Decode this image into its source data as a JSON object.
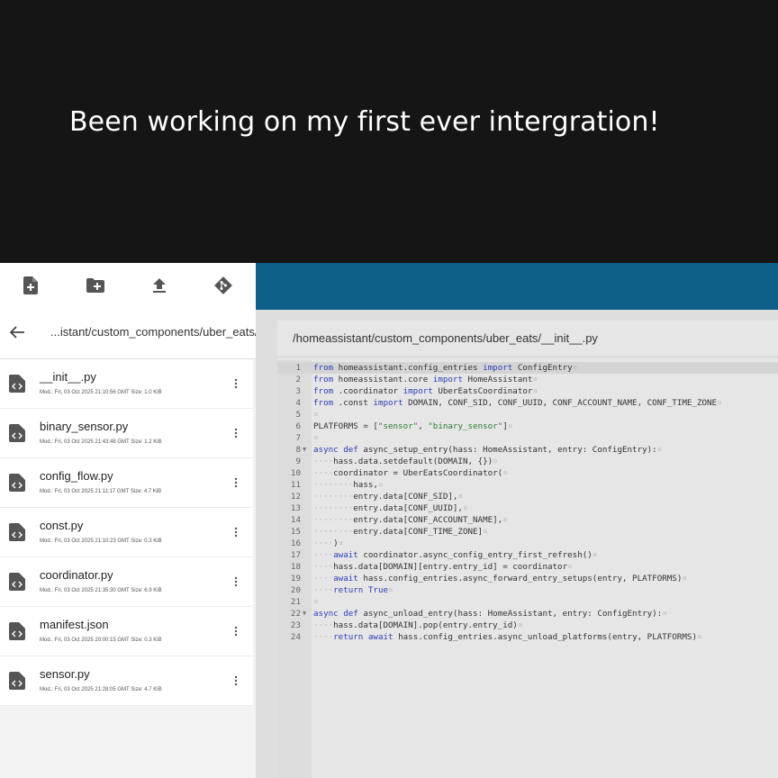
{
  "banner": {
    "caption": "Been working on my first ever intergration!"
  },
  "file_browser": {
    "toolbar": [
      {
        "icon": "new-file-icon",
        "name": "new-file-button"
      },
      {
        "icon": "new-folder-icon",
        "name": "new-folder-button"
      },
      {
        "icon": "upload-icon",
        "name": "upload-button"
      },
      {
        "icon": "git-icon",
        "name": "git-button"
      }
    ],
    "path": "...istant/custom_components/uber_eats/",
    "files": [
      {
        "name": "__init__.py",
        "meta": "Mod.: Fri, 03 Oct 2025 21:10:56 GMT  Size: 1.0 KiB"
      },
      {
        "name": "binary_sensor.py",
        "meta": "Mod.: Fri, 03 Oct 2025 21:43:48 GMT  Size: 1.2 KiB"
      },
      {
        "name": "config_flow.py",
        "meta": "Mod.: Fri, 03 Oct 2025 21:11:17 GMT  Size: 4.7 KiB"
      },
      {
        "name": "const.py",
        "meta": "Mod.: Fri, 03 Oct 2025 21:10:23 GMT  Size: 0.3 KiB"
      },
      {
        "name": "coordinator.py",
        "meta": "Mod.: Fri, 03 Oct 2025 21:35:30 GMT  Size: 6.9 KiB"
      },
      {
        "name": "manifest.json",
        "meta": "Mod.: Fri, 03 Oct 2025 20:00:15 GMT  Size: 0.3 KiB"
      },
      {
        "name": "sensor.py",
        "meta": "Mod.: Fri, 03 Oct 2025 21:28:05 GMT  Size: 4.7 KiB"
      }
    ]
  },
  "editor": {
    "file_path": "/homeassistant/custom_components/uber_eats/__init__.py",
    "code_lines": [
      "from homeassistant.config_entries import ConfigEntry",
      "from homeassistant.core import HomeAssistant",
      "from .coordinator import UberEatsCoordinator",
      "from .const import DOMAIN, CONF_SID, CONF_UUID, CONF_ACCOUNT_NAME, CONF_TIME_ZONE",
      "",
      "PLATFORMS = [\"sensor\", \"binary_sensor\"]",
      "",
      "async def async_setup_entry(hass: HomeAssistant, entry: ConfigEntry):",
      "    hass.data.setdefault(DOMAIN, {})",
      "    coordinator = UberEatsCoordinator(",
      "        hass,",
      "        entry.data[CONF_SID],",
      "        entry.data[CONF_UUID],",
      "        entry.data[CONF_ACCOUNT_NAME],",
      "        entry.data[CONF_TIME_ZONE]",
      "    )",
      "    await coordinator.async_config_entry_first_refresh()",
      "    hass.data[DOMAIN][entry.entry_id] = coordinator",
      "    await hass.config_entries.async_forward_entry_setups(entry, PLATFORMS)",
      "    return True",
      "",
      "async def async_unload_entry(hass: HomeAssistant, entry: ConfigEntry):",
      "    hass.data[DOMAIN].pop(entry.entry_id)",
      "    return await hass.config_entries.async_unload_platforms(entry, PLATFORMS)"
    ],
    "fold_lines": [
      8,
      22
    ],
    "active_line": 1,
    "colors": {
      "header": "#0e5e8a",
      "keyword": "#2b3eb8",
      "string": "#2e7d32"
    }
  }
}
